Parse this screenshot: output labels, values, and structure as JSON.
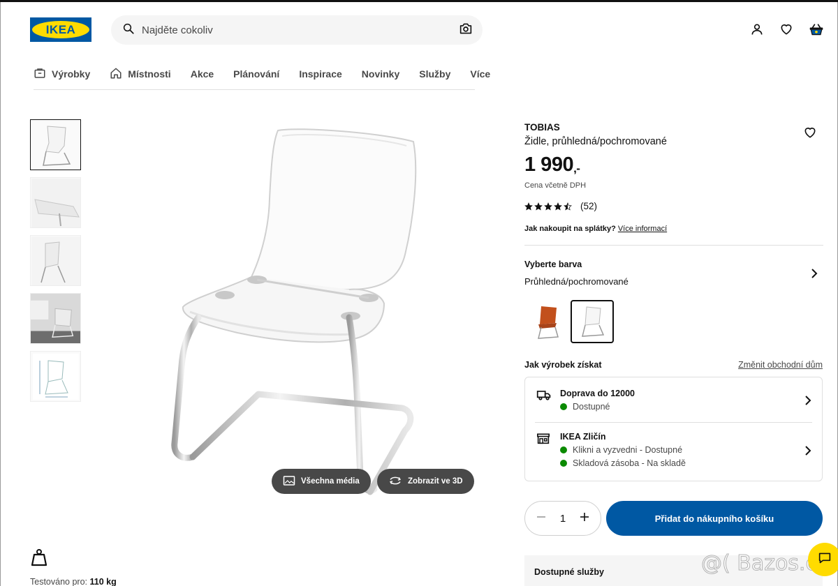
{
  "header": {
    "logo_text": "IKEA",
    "search_placeholder": "Najděte cokoliv",
    "icons": [
      "search-icon",
      "camera-icon",
      "user-icon",
      "heart-icon",
      "basket-icon"
    ]
  },
  "nav": [
    {
      "label": "Výrobky",
      "icon": "products-icon"
    },
    {
      "label": "Místnosti",
      "icon": "home-icon"
    },
    {
      "label": "Akce"
    },
    {
      "label": "Plánování"
    },
    {
      "label": "Inspirace"
    },
    {
      "label": "Novinky"
    },
    {
      "label": "Služby"
    },
    {
      "label": "Více"
    }
  ],
  "gallery": {
    "all_media_label": "Všechna média",
    "view_3d_label": "Zobrazit ve 3D",
    "tested_label": "Testováno pro:",
    "tested_value": "110 kg"
  },
  "product": {
    "name": "TOBIAS",
    "description": "Židle, průhledná/pochromované",
    "price": "1 990",
    "price_suffix": ",-",
    "vat_note": "Cena včetně DPH",
    "rating": 4.5,
    "reviews": "(52)",
    "installments_question": "Jak nakoupit na splátky?",
    "installments_link": "Více informací"
  },
  "color": {
    "heading": "Vyberte barva",
    "selected": "Průhledná/pochromované",
    "options": [
      "orange",
      "transparent"
    ],
    "selected_index": 1
  },
  "availability": {
    "heading": "Jak výrobek získat",
    "change_store": "Změnit obchodní dům",
    "delivery": {
      "title": "Doprava do 12000",
      "status": "Dostupné"
    },
    "store": {
      "title": "IKEA Zličín",
      "click_collect": "Klikni a vyzvedni - Dostupné",
      "stock": "Skladová zásoba - Na skladě"
    },
    "status_color": "#0a8a00"
  },
  "cart": {
    "quantity": "1",
    "add_label": "Přidat do nákupního košíku",
    "brand_color": "#0058a3"
  },
  "services": {
    "heading": "Dostupné služby"
  },
  "watermark": "@( Bazos.cz"
}
